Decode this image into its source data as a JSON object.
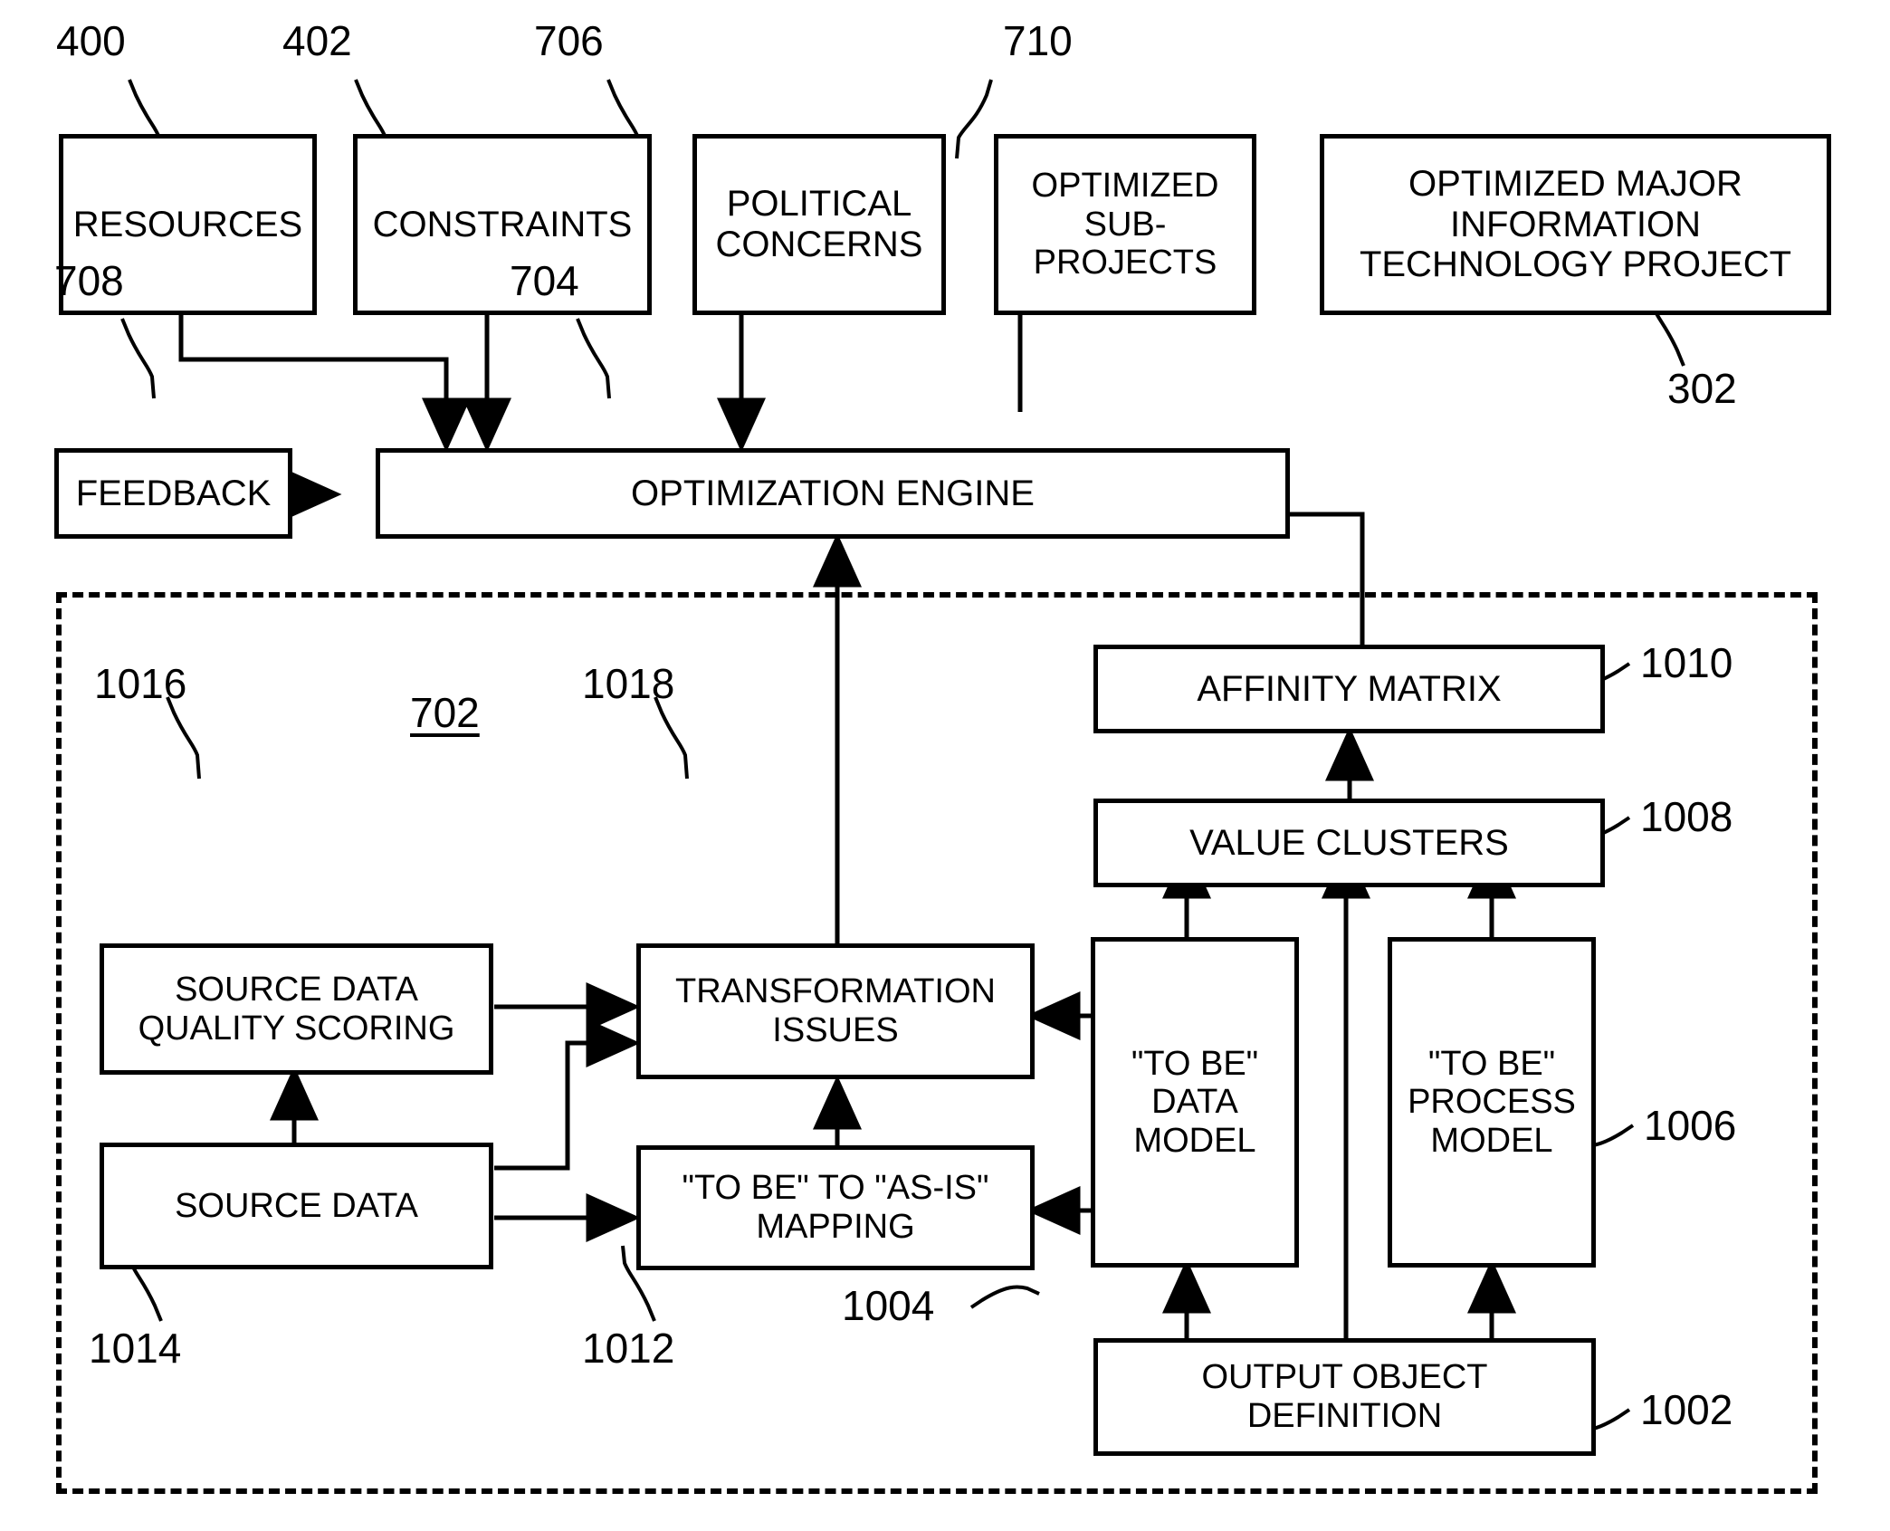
{
  "figure": {
    "title": "Optimization engine block diagram",
    "stroke_color": "#000000",
    "background_color": "#ffffff"
  },
  "boxes": {
    "resources": "RESOURCES",
    "constraints": "CONSTRAINTS",
    "political_concerns_l1": "POLITICAL",
    "political_concerns_l2": "CONCERNS",
    "optimized_subprojects_l1": "OPTIMIZED",
    "optimized_subprojects_l2": "SUB-",
    "optimized_subprojects_l3": "PROJECTS",
    "optimized_major_l1": "OPTIMIZED MAJOR",
    "optimized_major_l2": "INFORMATION",
    "optimized_major_l3": "TECHNOLOGY PROJECT",
    "feedback": "FEEDBACK",
    "optimization_engine": "OPTIMIZATION ENGINE",
    "affinity_matrix": "AFFINITY MATRIX",
    "value_clusters": "VALUE CLUSTERS",
    "source_data_quality_l1": "SOURCE DATA",
    "source_data_quality_l2": "QUALITY SCORING",
    "source_data": "SOURCE DATA",
    "transformation_issues_l1": "TRANSFORMATION",
    "transformation_issues_l2": "ISSUES",
    "tobe_asis_mapping_l1": "\"TO BE\" TO \"AS-IS\"",
    "tobe_asis_mapping_l2": "MAPPING",
    "tobe_data_model_l1": "\"TO BE\"",
    "tobe_data_model_l2": "DATA",
    "tobe_data_model_l3": "MODEL",
    "tobe_process_model_l1": "\"TO BE\"",
    "tobe_process_model_l2": "PROCESS",
    "tobe_process_model_l3": "MODEL",
    "output_object_definition_l1": "OUTPUT OBJECT",
    "output_object_definition_l2": "DEFINITION"
  },
  "reference_numerals": {
    "resources": "400",
    "constraints": "402",
    "political_concerns": "706",
    "optimized_subprojects": "710",
    "optimized_major_project": "302",
    "feedback": "708",
    "optimization_engine": "704",
    "dashed_group": "702",
    "affinity_matrix": "1010",
    "value_clusters": "1008",
    "tobe_process_model": "1006",
    "tobe_data_model": "1004",
    "output_object_definition": "1002",
    "source_data_quality_scoring": "1016",
    "transformation_issues": "1018",
    "source_data": "1014",
    "tobe_asis_mapping": "1012"
  }
}
